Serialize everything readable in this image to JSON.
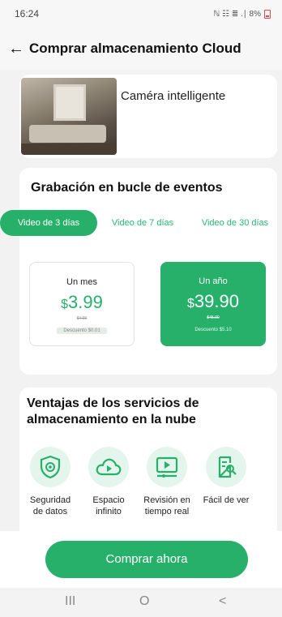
{
  "status_bar": {
    "time": "16:24",
    "indicators": "ℕ ☷ ≣ .∣ 8%"
  },
  "app_bar": {
    "title": "Comprar almacenamiento Cloud"
  },
  "device": {
    "name": "Caméra intelligente"
  },
  "plan": {
    "section_title": "Grabación en bucle de eventos",
    "tabs": [
      {
        "label": "Video de 3 días",
        "active": true
      },
      {
        "label": "Video de 7 días",
        "active": false
      },
      {
        "label": "Video de 30 días",
        "active": false
      }
    ],
    "options": [
      {
        "period": "Un mes",
        "currency": "$",
        "price": "3.99",
        "old_price": "$4.99",
        "discount": "Descuento $0.01",
        "selected": false
      },
      {
        "period": "Un año",
        "currency": "$",
        "price": "39.90",
        "old_price": "$45.00",
        "discount": "Descuento $5.10",
        "selected": true
      }
    ]
  },
  "benefits": {
    "title": "Ventajas de los servicios de almacenamiento en la nube",
    "items": [
      {
        "icon": "shield-icon",
        "label": "Seguridad de datos"
      },
      {
        "icon": "cloud-play-icon",
        "label": "Espacio infinito"
      },
      {
        "icon": "monitor-play-icon",
        "label": "Revisión en tiempo real"
      },
      {
        "icon": "document-search-icon",
        "label": "Fácil de ver"
      }
    ]
  },
  "buy_button": {
    "label": "Comprar ahora"
  },
  "nav": {
    "recents": "III",
    "home": "O",
    "back": "<"
  },
  "colors": {
    "accent": "#27b06a",
    "accent_light": "#e3f5ec",
    "background": "#f2f2f2"
  }
}
